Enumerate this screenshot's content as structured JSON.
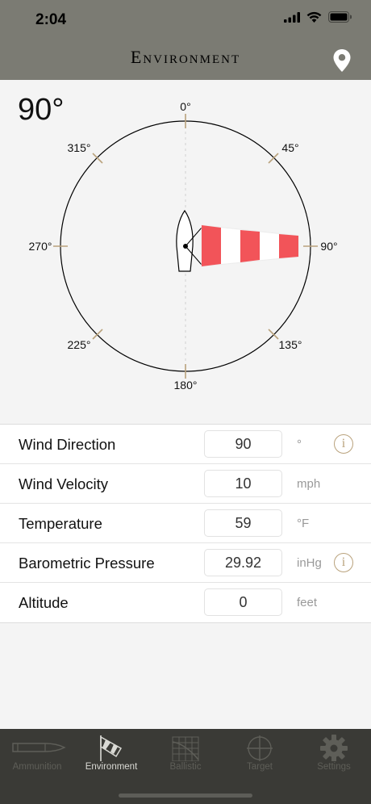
{
  "status_bar": {
    "time": "2:04"
  },
  "nav": {
    "title": "Environment"
  },
  "compass": {
    "heading_readout": "90°",
    "direction_degrees": 90,
    "labels": [
      "0°",
      "45°",
      "90°",
      "135°",
      "180°",
      "225°",
      "270°",
      "315°"
    ],
    "accent_color": "#b9a27c",
    "windsock_color": "#f25459"
  },
  "form": {
    "rows": [
      {
        "label": "Wind Direction",
        "value": "90",
        "unit": "°",
        "has_info": true
      },
      {
        "label": "Wind Velocity",
        "value": "10",
        "unit": "mph",
        "has_info": false
      },
      {
        "label": "Temperature",
        "value": "59",
        "unit": "°F",
        "has_info": false
      },
      {
        "label": "Barometric Pressure",
        "value": "29.92",
        "unit": "inHg",
        "has_info": true
      },
      {
        "label": "Altitude",
        "value": "0",
        "unit": "feet",
        "has_info": false
      }
    ]
  },
  "tabbar": {
    "tabs": [
      {
        "label": "Ammunition",
        "icon": "bullet-icon",
        "active": false
      },
      {
        "label": "Environment",
        "icon": "windsock-icon",
        "active": true
      },
      {
        "label": "Ballistic",
        "icon": "ballistic-grid-icon",
        "active": false
      },
      {
        "label": "Target",
        "icon": "crosshair-icon",
        "active": false
      },
      {
        "label": "Settings",
        "icon": "gear-icon",
        "active": false
      }
    ]
  }
}
